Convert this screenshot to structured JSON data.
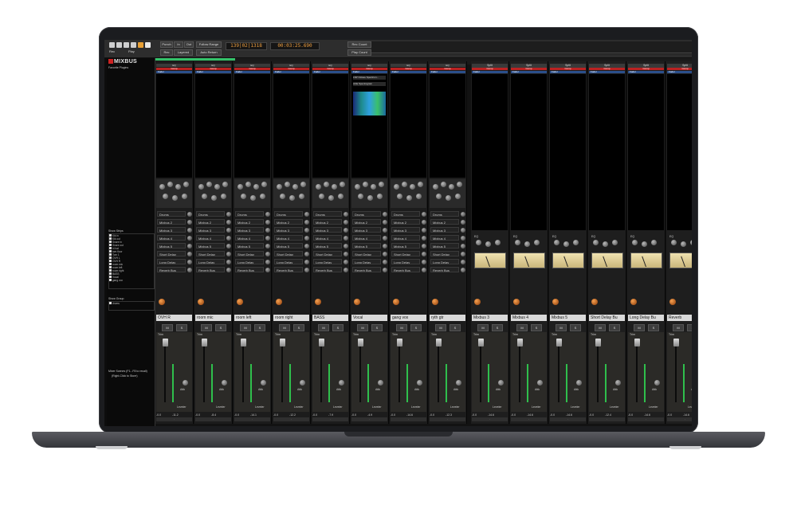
{
  "app": {
    "logo": "MIXBUS",
    "favorite_plugins": "Favorite Plugins"
  },
  "toolbar": {
    "punch": "Punch",
    "in": "In",
    "out": "Out",
    "follow_range": "Follow Range",
    "play": "Play",
    "rec": "Rec",
    "layered": "Layered",
    "auto_return": "Auto Return",
    "bbt": "139|02|1318",
    "timecode": "00:03:25.690",
    "rec_count": "Rec Count",
    "play_count": "Play Count"
  },
  "sidebar": {
    "strips_header": "Show   Strips",
    "strips": [
      "Kik in",
      "Kik out",
      "Snare in",
      "Snare out",
      "hi hat",
      "tom floor",
      "Tom 1",
      "OVH L",
      "OVH R",
      "room mic",
      "room left",
      "room right",
      "BASS",
      "Vocal",
      "gang vox"
    ],
    "groups_header": "Show   Group",
    "groups": [
      "drums"
    ],
    "scenes_header": "Mixer Scenes (F1...F8 to recall)",
    "scenes_hint": "(Right-Click to Store)"
  },
  "channel_common": {
    "eq": "EQ",
    "comp": "Comp",
    "fader": "Fader",
    "mute": "M",
    "solo": "S",
    "sends": [
      "Drums",
      "Mixbus 2",
      "Mixbus 3",
      "Mixbus 4",
      "Mixbus 5",
      "Short Delay",
      "Long Delay",
      "Reverb Bus"
    ],
    "split": "Split",
    "trim": "Trim",
    "gain": "Gain",
    "attk": "Attk",
    "leveler": "Leveler"
  },
  "channels": [
    {
      "name": "OVH R",
      "v1": "-0.0",
      "v2": "-11.2"
    },
    {
      "name": "room mic",
      "v1": "-0.0",
      "v2": "-8.4"
    },
    {
      "name": "room left",
      "v1": "-0.0",
      "v2": "-14.1"
    },
    {
      "name": "room right",
      "v1": "-0.0",
      "v2": "-12.2"
    },
    {
      "name": "BASS",
      "v1": "-0.0",
      "v2": "-7.9"
    },
    {
      "name": "Vocal",
      "v1": "-0.0",
      "v2": "-4.9"
    },
    {
      "name": "gang vox",
      "v1": "-0.0",
      "v2": "-14.6"
    },
    {
      "name": "ryth gtr",
      "v1": "-0.0",
      "v2": "-12.3"
    }
  ],
  "buses": [
    {
      "name": "Mixbus 3",
      "v1": "-0.0",
      "v2": "-14.6"
    },
    {
      "name": "Mixbus 4",
      "v1": "-0.0",
      "v2": "-14.6"
    },
    {
      "name": "Mixbus 5",
      "v1": "-0.0",
      "v2": "-14.6"
    },
    {
      "name": "Short Delay Bu",
      "v1": "-0.0",
      "v2": "-12.4"
    },
    {
      "name": "Long Delay Bu",
      "v1": "-0.0",
      "v2": "-14.6"
    },
    {
      "name": "Reverb",
      "v1": "-0.0",
      "v2": "-14.6"
    }
  ],
  "plugins": {
    "vocal_1": "LSP Octave Spectrum...",
    "vocal_2": "ACE Spectrogram"
  },
  "colors": {
    "accent_green": "#35c26a",
    "comp_red": "#b22222",
    "fader_blue": "#2b4f8a",
    "clock": "#f0a040"
  }
}
